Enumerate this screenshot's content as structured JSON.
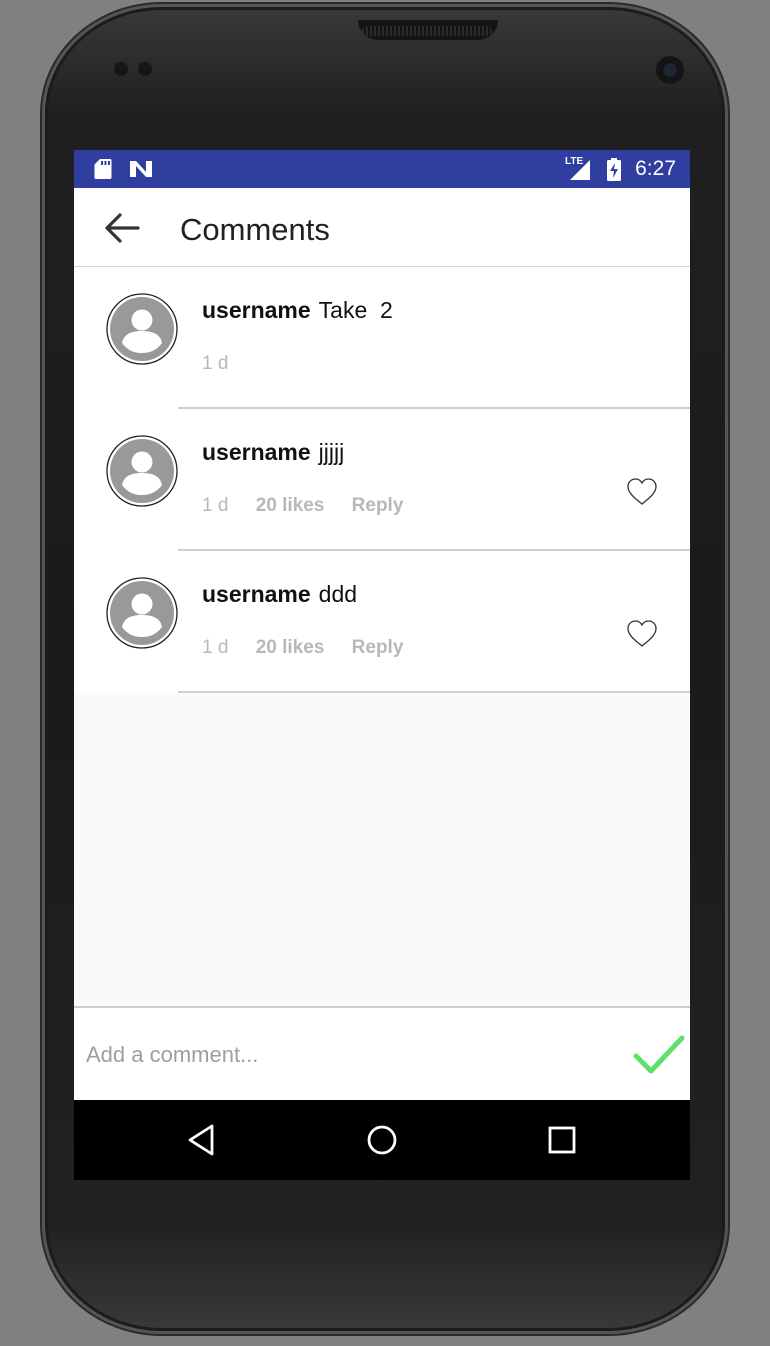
{
  "status_bar": {
    "time": "6:27",
    "network_badge": "LTE",
    "left_icons": [
      "sd-card-icon",
      "n-notification-icon"
    ],
    "right_icons": [
      "signal-icon",
      "battery-charging-icon"
    ]
  },
  "app_bar": {
    "title": "Comments",
    "back_icon": "arrow-back-icon"
  },
  "comments": [
    {
      "username": "username",
      "text": "Take  2",
      "age": "1 d",
      "likes": "",
      "reply": "",
      "liked": null
    },
    {
      "username": "username",
      "text": "jjjjj",
      "age": "1 d",
      "likes": "20 likes",
      "reply": "Reply",
      "liked": false
    },
    {
      "username": "username",
      "text": "ddd",
      "age": "1 d",
      "likes": "20 likes",
      "reply": "Reply",
      "liked": false
    }
  ],
  "composer": {
    "placeholder": "Add a comment...",
    "send_icon": "checkmark-icon"
  },
  "colors": {
    "status_bar": "#303f9f",
    "send_check": "#5ee06a",
    "meta_text": "#b8b8b8"
  },
  "nav_bar": {
    "buttons": [
      "back-triangle-icon",
      "home-circle-icon",
      "recents-square-icon"
    ]
  }
}
